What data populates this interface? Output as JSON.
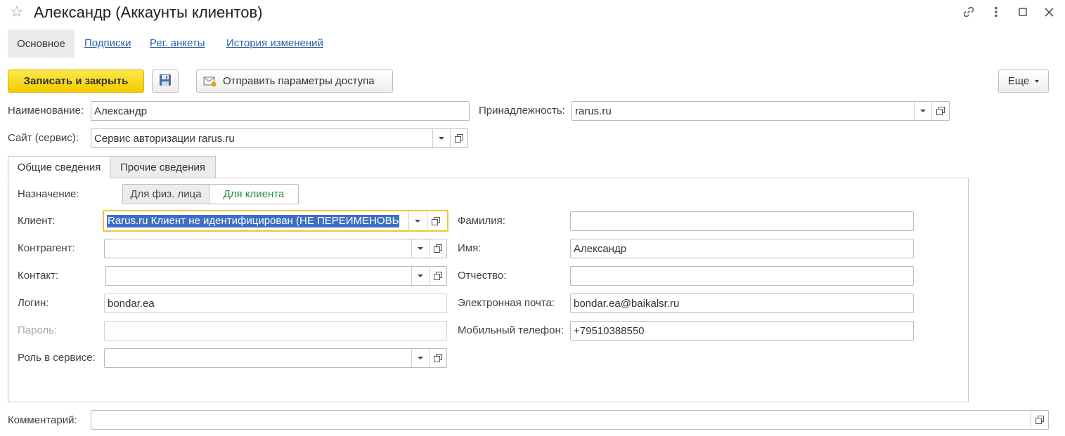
{
  "window": {
    "title": "Александр (Аккаунты клиентов)"
  },
  "nav": {
    "tabs": [
      {
        "label": "Основное"
      },
      {
        "label": "Подписки"
      },
      {
        "label": "Рег. анкеты"
      },
      {
        "label": "История изменений"
      }
    ]
  },
  "toolbar": {
    "save_close_label": "Записать и закрыть",
    "send_access_label": "Отправить параметры доступа",
    "more_label": "Еще"
  },
  "header_fields": {
    "name": {
      "label": "Наименование:",
      "value": "Александр"
    },
    "belonging": {
      "label": "Принадлежность:",
      "value": "rarus.ru"
    },
    "site": {
      "label": "Сайт (сервис):",
      "value": "Сервис авторизации rarus.ru"
    }
  },
  "tabs": [
    {
      "label": "Общие сведения"
    },
    {
      "label": "Прочие сведения"
    }
  ],
  "general": {
    "purpose": {
      "label": "Назначение:",
      "options": [
        "Для физ. лица",
        "Для клиента"
      ]
    },
    "client": {
      "label": "Клиент:",
      "value": "Rarus.ru Клиент не идентифицирован (НЕ ПЕРЕИМЕНОВЬ"
    },
    "counterparty": {
      "label": "Контрагент:",
      "value": ""
    },
    "contact": {
      "label": "Контакт:",
      "value": ""
    },
    "login": {
      "label": "Логин:",
      "value": "bondar.ea"
    },
    "password": {
      "label": "Пароль:",
      "value": ""
    },
    "role": {
      "label": "Роль в сервисе:",
      "value": ""
    },
    "surname": {
      "label": "Фамилия:",
      "value": ""
    },
    "first_name": {
      "label": "Имя:",
      "value": "Александр"
    },
    "patronymic": {
      "label": "Отчество:",
      "value": ""
    },
    "email": {
      "label": "Электронная почта:",
      "value": "bondar.ea@baikalsr.ru"
    },
    "phone": {
      "label": "Мобильный телефон:",
      "value": "+79510388550"
    }
  },
  "comment": {
    "label": "Комментарий:",
    "value": ""
  },
  "colors": {
    "primary_button": "#f3cc00",
    "link": "#2c5fa3",
    "focus_border": "#f0c53c",
    "selection": "#3e6ec4",
    "toggle_active_text": "#2b8a3e"
  }
}
